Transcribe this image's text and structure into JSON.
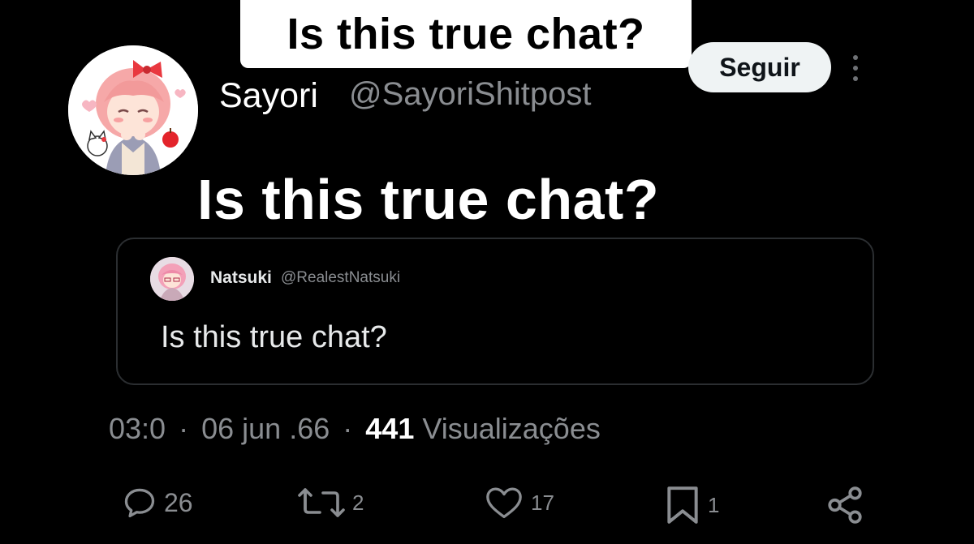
{
  "caption": {
    "text": "Is this true chat?"
  },
  "author": {
    "display_name": "Sayori",
    "handle": "@SayoriShitpost"
  },
  "follow_button": {
    "label": "Seguir"
  },
  "tweet": {
    "text": "Is this true chat?"
  },
  "quoted_tweet": {
    "display_name": "Natsuki",
    "handle": "@RealestNatsuki",
    "text": "Is this true chat?"
  },
  "meta": {
    "time": "03:0",
    "separator": "·",
    "date": "06 jun .66",
    "views_count": "441",
    "views_label": "Visualizações"
  },
  "actions": {
    "replies": "26",
    "retweets": "2",
    "likes": "17",
    "bookmarks": "1"
  },
  "icons": {
    "reply": "reply-icon",
    "retweet": "retweet-icon",
    "like": "heart-icon",
    "bookmark": "bookmark-icon",
    "share": "share-icon",
    "more": "more-vertical-icon"
  },
  "colors": {
    "background": "#000000",
    "text_primary": "#ffffff",
    "text_secondary": "#8a8d91",
    "border": "#2b2e31",
    "follow_button_bg": "#eff3f4"
  }
}
